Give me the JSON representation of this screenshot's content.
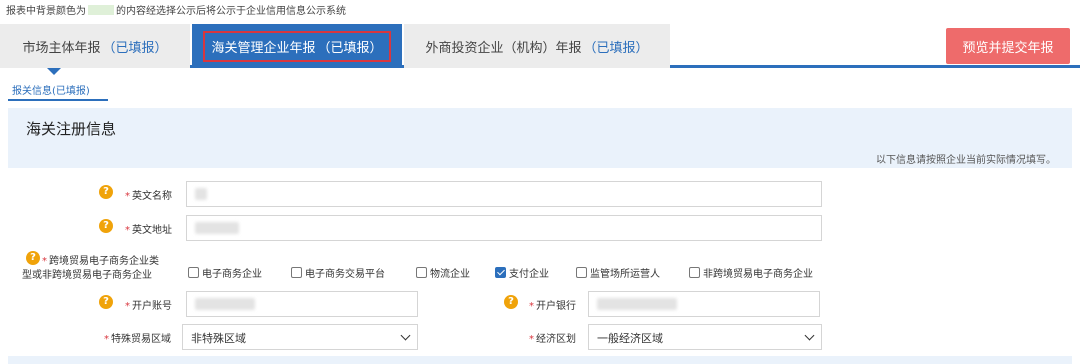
{
  "notice": {
    "prefix": "报表中背景颜色为",
    "suffix": "的内容经选择公示后将公示于企业信用信息公示系统",
    "swatch_color": "#dff0d8"
  },
  "tabs": [
    {
      "label": "市场主体年报",
      "status": "（已填报）"
    },
    {
      "label": "海关管理企业年报",
      "status": "（已填报）"
    },
    {
      "label": "外商投资企业（机构）年报",
      "status": "（已填报）"
    }
  ],
  "preview_button": "预览并提交年报",
  "subtab": "报关信息(已填报)",
  "section": {
    "title": "海关注册信息",
    "hint": "以下信息请按照企业当前实际情况填写。"
  },
  "fields": {
    "english_name": {
      "label": "英文名称",
      "required": "*"
    },
    "english_address": {
      "label": "英文地址",
      "required": "*"
    },
    "ecommerce_type": {
      "label_line1": "跨境贸易电子商务企业类",
      "label_line2": "型或非跨境贸易电子商务企业",
      "required": "*",
      "options": [
        {
          "label": "电子商务企业",
          "checked": false
        },
        {
          "label": "电子商务交易平台",
          "checked": false
        },
        {
          "label": "物流企业",
          "checked": false
        },
        {
          "label": "支付企业",
          "checked": true
        },
        {
          "label": "监管场所运营人",
          "checked": false
        },
        {
          "label": "非跨境贸易电子商务企业",
          "checked": false
        }
      ]
    },
    "account_number": {
      "label": "开户账号",
      "required": "*"
    },
    "bank": {
      "label": "开户银行",
      "required": "*"
    },
    "special_trade_zone": {
      "label": "特殊贸易区域",
      "required": "*",
      "value": "非特殊区域"
    },
    "economic_zone": {
      "label": "经济区划",
      "required": "*",
      "value": "一般经济区域"
    }
  },
  "icons": {
    "help": "?"
  },
  "colors": {
    "accent": "#2c6fbc",
    "highlight": "#d9363e",
    "preview": "#ee6b6b",
    "help": "#f0a30a"
  }
}
